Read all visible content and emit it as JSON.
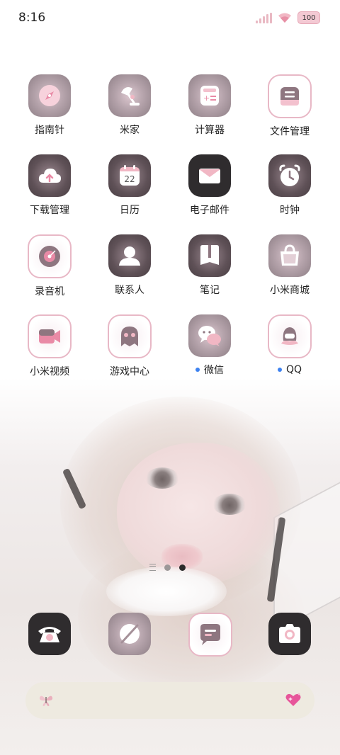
{
  "status_bar": {
    "time": "8:16",
    "battery": "100",
    "icons": [
      "signal-icon",
      "wifi-icon",
      "battery-icon"
    ]
  },
  "apps": [
    {
      "label": "指南针",
      "icon": "compass-icon"
    },
    {
      "label": "米家",
      "icon": "lamp-icon"
    },
    {
      "label": "计算器",
      "icon": "calculator-icon"
    },
    {
      "label": "文件管理",
      "icon": "folder-icon"
    },
    {
      "label": "下载管理",
      "icon": "cloud-download-icon"
    },
    {
      "label": "日历",
      "icon": "calendar-icon",
      "calendar_day": "22"
    },
    {
      "label": "电子邮件",
      "icon": "envelope-icon"
    },
    {
      "label": "时钟",
      "icon": "alarm-clock-icon"
    },
    {
      "label": "录音机",
      "icon": "record-icon"
    },
    {
      "label": "联系人",
      "icon": "person-icon"
    },
    {
      "label": "笔记",
      "icon": "notebook-icon"
    },
    {
      "label": "小米商城",
      "icon": "shopping-bag-icon"
    },
    {
      "label": "小米视频",
      "icon": "video-camera-icon"
    },
    {
      "label": "游戏中心",
      "icon": "ghost-icon"
    },
    {
      "label": "微信",
      "icon": "chat-bubbles-icon",
      "notification": true
    },
    {
      "label": "QQ",
      "icon": "penguin-icon",
      "notification": true
    }
  ],
  "dock": [
    {
      "icon": "phone-icon"
    },
    {
      "icon": "browser-icon"
    },
    {
      "icon": "message-icon"
    },
    {
      "icon": "camera-icon"
    }
  ],
  "page_indicator": {
    "pages": 2,
    "active": 2
  },
  "search_bar": {
    "left_icon": "butterfly-icon",
    "right_icon": "sparkling-heart-icon"
  },
  "colors": {
    "accent_pink": "#e98aa6",
    "dark_tile": "#2f2c2e",
    "notification_dot": "#3d82f0",
    "search_bg": "#eeeae0"
  }
}
